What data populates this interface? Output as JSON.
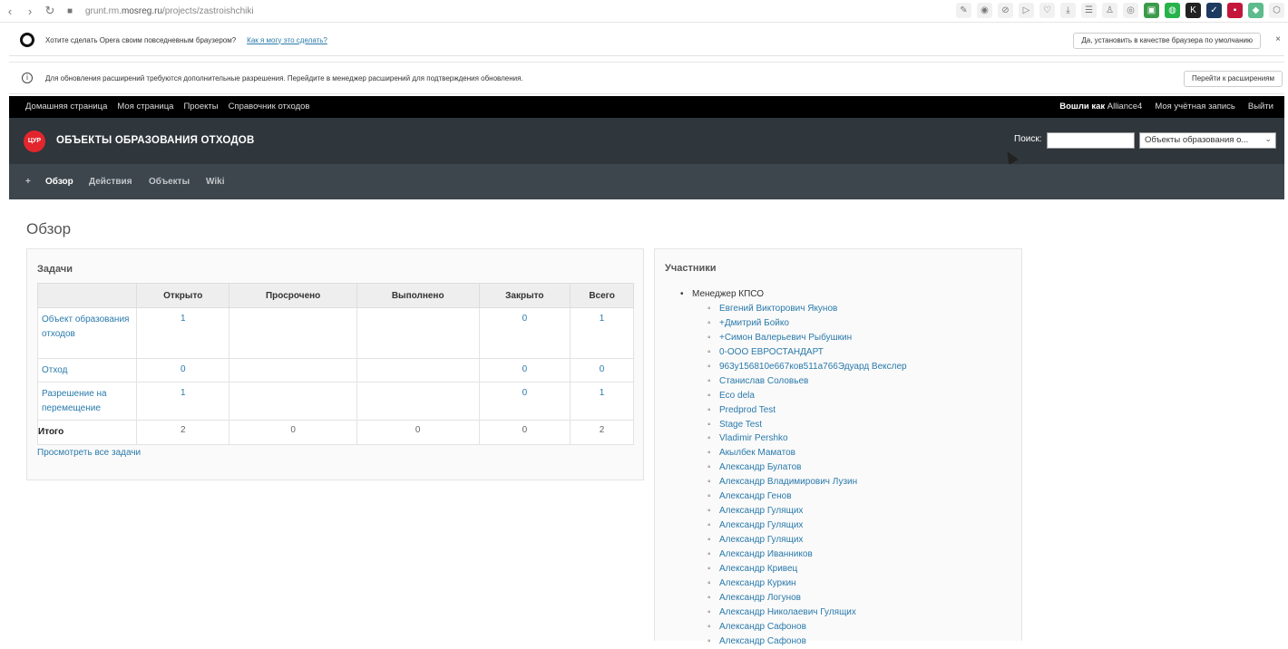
{
  "browser": {
    "url_prefix": "grunt.rm.",
    "url_domain": "mosreg.ru",
    "url_path": "/projects/zastroishchiki"
  },
  "opera_notice": {
    "text": "Хотите сделать Opera своим повседневным браузером?",
    "link": "Как я могу это сделать?",
    "button": "Да, установить в качестве браузера по умолчанию",
    "close": "×"
  },
  "ext_notice": {
    "text": "Для обновления расширений требуются дополнительные разрешения. Перейдите в менеджер расширений для подтверждения обновления.",
    "button": "Перейти к расширениям"
  },
  "top_menu": {
    "items": [
      "Домашняя страница",
      "Моя страница",
      "Проекты",
      "Справочник отходов"
    ],
    "logged_as_label": "Вошли как",
    "user": "Alliance4",
    "my_account": "Моя учётная запись",
    "logout": "Выйти"
  },
  "header": {
    "logo_text": "ЦУР",
    "title": "ОБЪЕКТЫ ОБРАЗОВАНИЯ ОТХОДОВ",
    "search_label": "Поиск:",
    "search_value": "",
    "project_select": "Объекты образования о..."
  },
  "main_menu": {
    "new": "+",
    "overview": "Обзор",
    "activity": "Действия",
    "objects": "Объекты",
    "wiki": "Wiki"
  },
  "page_title": "Обзор",
  "issues": {
    "title": "Задачи",
    "columns": [
      "",
      "Открыто",
      "Просрочено",
      "Выполнено",
      "Закрыто",
      "Всего"
    ],
    "rows": [
      {
        "name": "Объект образования отходов",
        "open": "1",
        "overdue": "",
        "done": "",
        "closed": "0",
        "total": "1"
      },
      {
        "name": "Отход",
        "open": "0",
        "overdue": "",
        "done": "",
        "closed": "0",
        "total": "0"
      },
      {
        "name": "Разрешение на перемещение",
        "open": "1",
        "overdue": "",
        "done": "",
        "closed": "0",
        "total": "1"
      }
    ],
    "total_row": {
      "name": "Итого",
      "open": "2",
      "overdue": "0",
      "done": "0",
      "closed": "0",
      "total": "2"
    },
    "view_all": "Просмотреть все задачи"
  },
  "members": {
    "title": "Участники",
    "role": "Менеджер КПСО",
    "people": [
      "Евгений Викторович Якунов",
      "+Дмитрий Бойко",
      "+Симон Валерьевич Рыбушкин",
      "0-ООО ЕВРОСТАНДАРТ",
      "963у156810е667ков511а766Эдуард Векслер",
      "Станислав Соловьев",
      "Eco dela",
      "Predprod Test",
      "Stage Test",
      "Vladimir Pershko",
      "Акылбек Маматов",
      "Александр Булатов",
      "Александр Владимирович Лузин",
      "Александр Генов",
      "Александр Гулящих",
      "Александр Гулящих",
      "Александр Гулящих",
      "Александр Иванников",
      "Александр Кривец",
      "Александр Куркин",
      "Александр Логунов",
      "Александр Николаевич Гулящих",
      "Александр Сафонов",
      "Александр Сафонов"
    ]
  }
}
